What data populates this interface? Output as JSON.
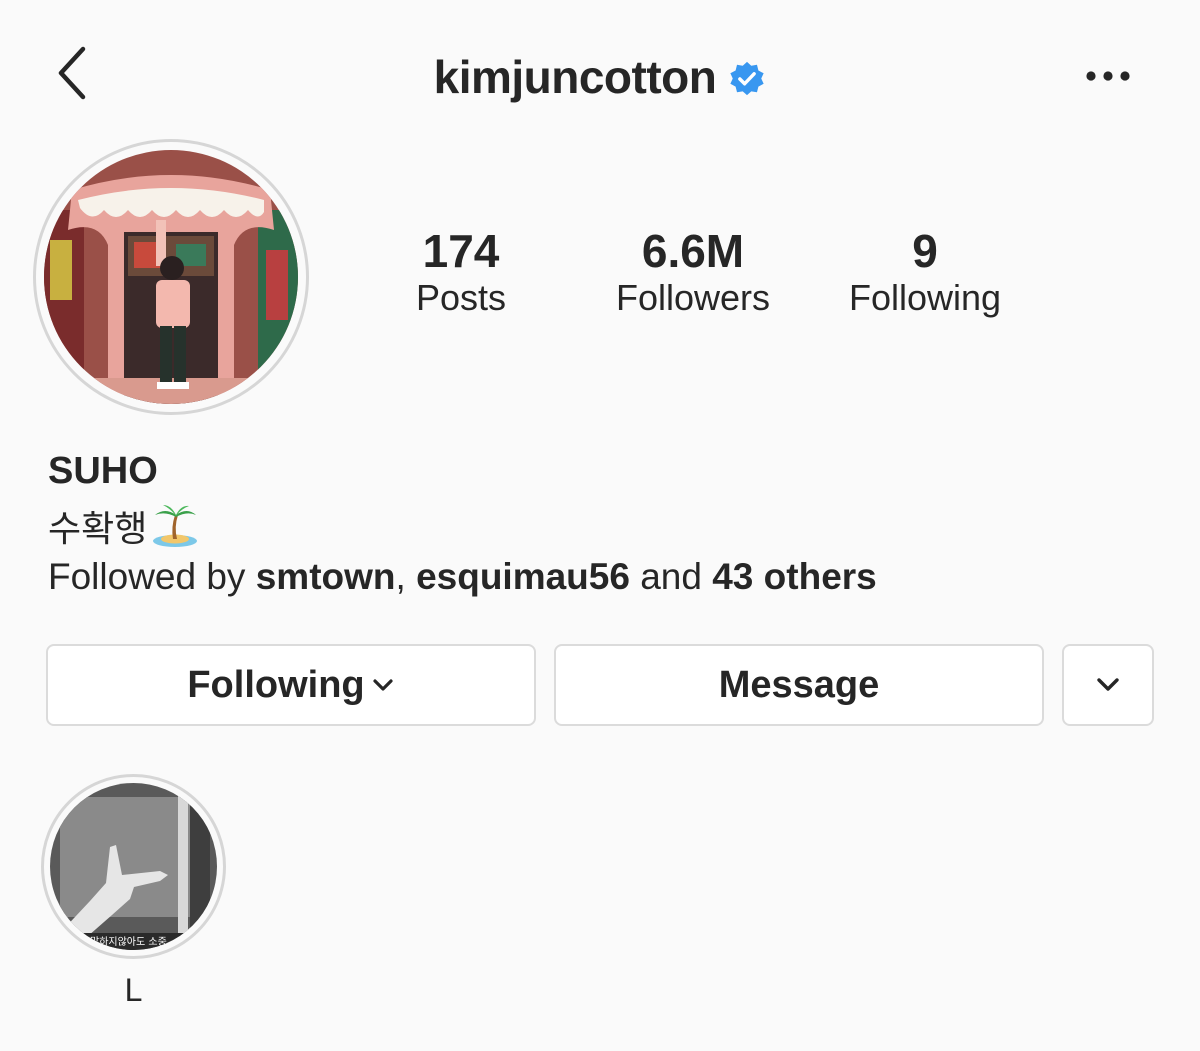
{
  "header": {
    "username": "kimjuncotton",
    "verified_icon": "verified-badge-icon",
    "back_icon": "chevron-left-icon",
    "more_icon": "more-horizontal-icon",
    "verified_color": "#3897f0"
  },
  "stats": {
    "posts": {
      "count": "174",
      "label": "Posts"
    },
    "followers": {
      "count": "6.6M",
      "label": "Followers"
    },
    "following": {
      "count": "9",
      "label": "Following"
    }
  },
  "bio": {
    "display_name": "SUHO",
    "text": "수확행",
    "emoji_icon": "palm-tree-island-icon",
    "followed_by": {
      "prefix": "Followed by",
      "user1": "smtown",
      "separator": ",",
      "user2": "esquimau56",
      "middle": "and",
      "others": "43 others"
    }
  },
  "buttons": {
    "following": "Following",
    "message": "Message",
    "suggest_icon": "chevron-down-icon"
  },
  "highlights": [
    {
      "label": "L",
      "caption": "말하지않아도 소중"
    }
  ]
}
